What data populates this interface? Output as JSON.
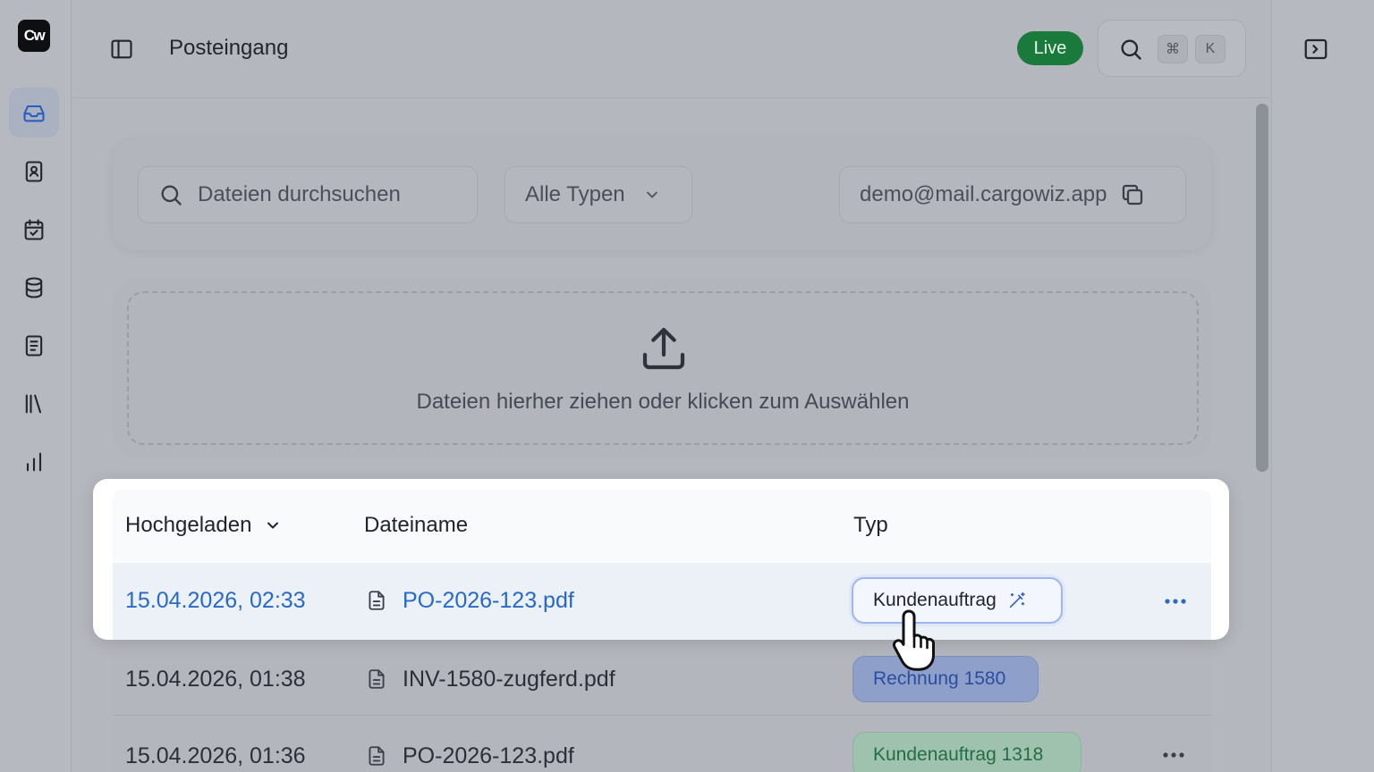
{
  "app": {
    "logo_text": "Cw",
    "page_title": "Posteingang",
    "live_label": "Live",
    "shortcut_keys": [
      "⌘",
      "K"
    ]
  },
  "sidebar": {
    "items": [
      {
        "icon": "inbox-icon",
        "active": true
      },
      {
        "icon": "contacts-book-icon",
        "active": false
      },
      {
        "icon": "calendar-check-icon",
        "active": false
      },
      {
        "icon": "database-icon",
        "active": false
      },
      {
        "icon": "document-list-icon",
        "active": false
      },
      {
        "icon": "library-icon",
        "active": false
      },
      {
        "icon": "bar-chart-icon",
        "active": false
      }
    ]
  },
  "filters": {
    "search_placeholder": "Dateien durchsuchen",
    "type_select": "Alle Typen",
    "email": "demo@mail.cargowiz.app"
  },
  "dropzone": {
    "text": "Dateien hierher ziehen oder klicken zum Auswählen"
  },
  "table": {
    "columns": {
      "uploaded": "Hochgeladen",
      "filename": "Dateiname",
      "type": "Typ"
    },
    "rows": [
      {
        "uploaded": "15.04.2026, 02:33",
        "filename": "PO-2026-123.pdf",
        "type": "Kundenauftrag",
        "selected": true
      },
      {
        "uploaded": "15.04.2026, 01:38",
        "filename": "INV-1580-zugferd.pdf",
        "type": "Rechnung 1580",
        "selected": false
      },
      {
        "uploaded": "15.04.2026, 01:36",
        "filename": "PO-2026-123.pdf",
        "type": "Kundenauftrag 1318",
        "selected": false
      }
    ]
  },
  "colors": {
    "live_green": "#1a7a3c",
    "link_blue": "#2769c9",
    "chip_blue_text": "#2b4fa0",
    "chip_green_text": "#246e45"
  }
}
